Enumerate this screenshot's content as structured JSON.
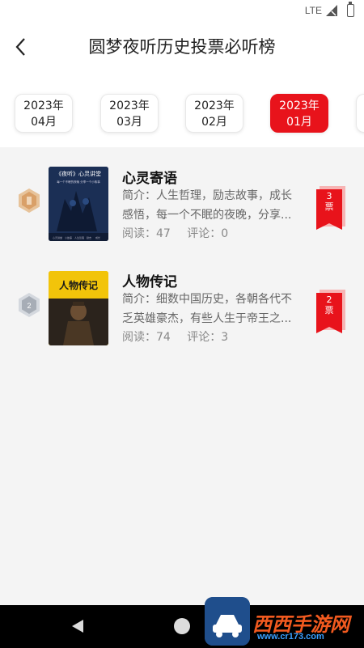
{
  "status_bar": {
    "network": "LTE"
  },
  "header": {
    "title": "圆梦夜听历史投票必听榜"
  },
  "tabs": [
    {
      "year": "2023年",
      "month": "04月",
      "active": false
    },
    {
      "year": "2023年",
      "month": "03月",
      "active": false
    },
    {
      "year": "2023年",
      "month": "02月",
      "active": false
    },
    {
      "year": "2023年",
      "month": "01月",
      "active": true
    }
  ],
  "items": [
    {
      "rank_icon": "bronze-rank-icon",
      "title": "心灵寄语",
      "desc": "简介：人生哲理，励志故事，成长感悟，每一个不眠的夜晚，分享...",
      "read": "阅读：47",
      "comment": "评论：0",
      "votes": "3",
      "vote_unit": "票",
      "cover": {
        "heading": "《夜听》心灵讲堂",
        "subtitle": "每一个不眠的夜晚  分享一个小故事",
        "footer": [
          "心灵讲堂",
          "小故事",
          "人生哲理",
          "励志",
          "成长"
        ]
      }
    },
    {
      "rank_icon": "silver-rank-icon",
      "title": "人物传记",
      "desc": "简介：细数中国历史，各朝各代不乏英雄豪杰，有些人生于帝王之...",
      "read": "阅读：74",
      "comment": "评论：3",
      "votes": "2",
      "vote_unit": "票",
      "cover": {
        "heading": "人物传记"
      }
    }
  ],
  "watermark": {
    "text": "西西手游网",
    "sub": "www.cr173.com"
  },
  "colors": {
    "accent": "#e8131b",
    "background": "#f4f4f4"
  }
}
